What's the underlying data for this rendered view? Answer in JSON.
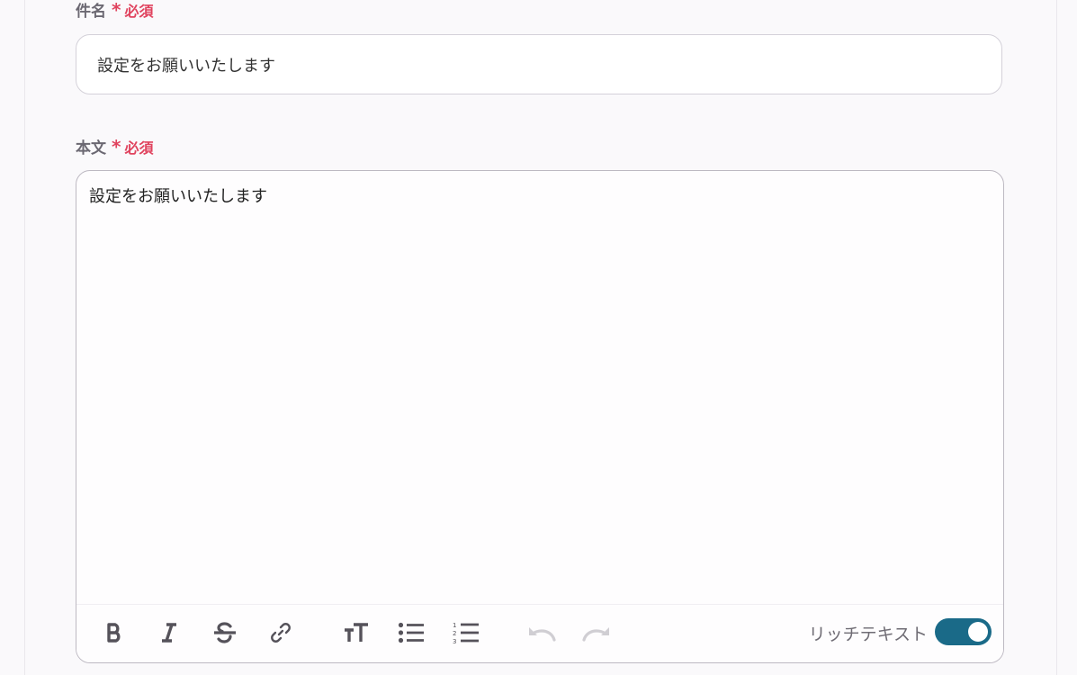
{
  "subject": {
    "label": "件名",
    "required_mark": "*",
    "required_text": "必須",
    "value": "設定をお願いいたします"
  },
  "body": {
    "label": "本文",
    "required_mark": "*",
    "required_text": "必須",
    "value": "設定をお願いいたします"
  },
  "toolbar": {
    "buttons": [
      "bold-icon",
      "italic-icon",
      "strikethrough-icon",
      "link-icon",
      "text-size-icon",
      "bullet-list-icon",
      "numbered-list-icon",
      "undo-icon",
      "redo-icon"
    ],
    "rich_text_label": "リッチテキスト",
    "rich_text_enabled": true
  },
  "colors": {
    "required": "#e0435e",
    "toggle_on": "#1a6a88",
    "icon_active": "#55525a",
    "icon_disabled": "#d0ced3"
  }
}
